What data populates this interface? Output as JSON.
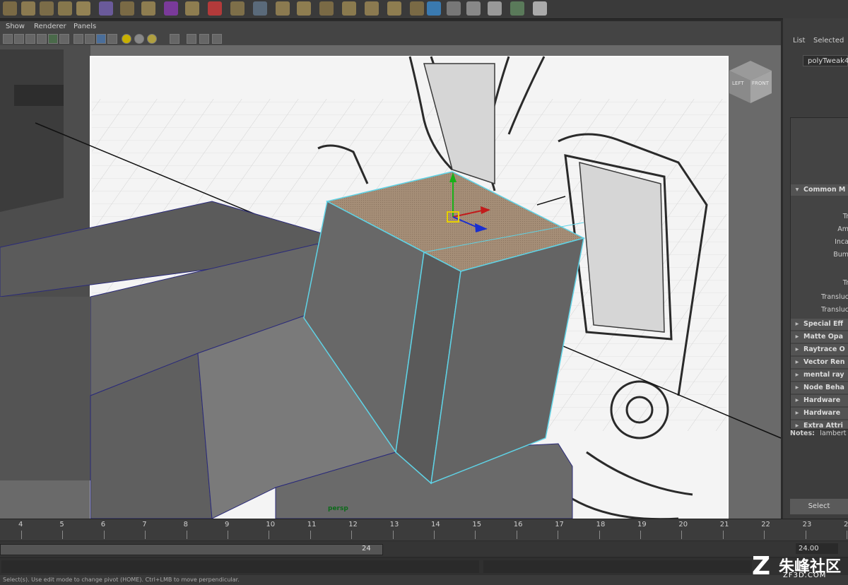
{
  "menubar": {
    "show": "Show",
    "renderer": "Renderer",
    "panels": "Panels"
  },
  "viewport": {
    "camera_label": "persp",
    "viewcube_left": "LEFT",
    "viewcube_front": "FRONT"
  },
  "sidepanel": {
    "tab_list": "List",
    "tab_selected": "Selected",
    "node_name": "polyTweak4",
    "section_common": "Common M",
    "labels": [
      "Tr",
      "Am",
      "Inca",
      "Bum",
      "Tr",
      "Transluc",
      "Transluc"
    ],
    "sections": [
      "Special Eff",
      "Matte Opa",
      "Raytrace O",
      "Vector Ren",
      "mental ray",
      "Node Beha",
      "Hardware",
      "Hardware",
      "Extra Attri"
    ],
    "notes_label": "Notes:",
    "notes_value": "lambert",
    "select_button": "Select"
  },
  "timeline": {
    "frames": [
      "4",
      "5",
      "6",
      "7",
      "8",
      "9",
      "10",
      "11",
      "12",
      "13",
      "14",
      "15",
      "16",
      "17",
      "18",
      "19",
      "20",
      "21",
      "22",
      "23",
      "2"
    ]
  },
  "range": {
    "end_value": "24",
    "field_value": "24.00"
  },
  "help_line": "Select(s). Use edit mode to change pivot (HOME). Ctrl+LMB to move perpendicular.",
  "watermark": {
    "text": "朱峰社区",
    "url": "ZF3D.COM"
  },
  "colors": {
    "background": "#2b2b2b",
    "viewport_bg": "#6f6f6f",
    "selection": "#5fd3e6",
    "face_highlight": "#a58e77",
    "manip_x": "#c21b1b",
    "manip_y": "#18b018",
    "manip_z": "#1a2fd0",
    "pivot": "#e6d000",
    "camera_label": "#0c6b1a"
  }
}
